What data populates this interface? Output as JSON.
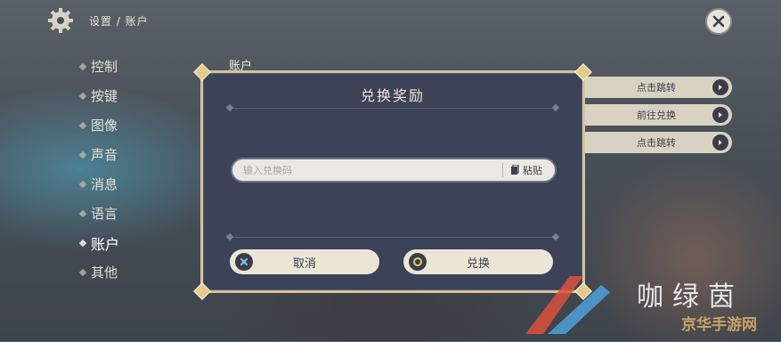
{
  "topbar": {
    "breadcrumb": "设置 / 账户"
  },
  "sidebar": {
    "items": [
      {
        "label": "控制"
      },
      {
        "label": "按键"
      },
      {
        "label": "图像"
      },
      {
        "label": "声音"
      },
      {
        "label": "消息"
      },
      {
        "label": "语言"
      },
      {
        "label": "账户",
        "active": true
      },
      {
        "label": "其他"
      }
    ]
  },
  "main": {
    "section_title": "账户",
    "buttons": [
      {
        "label": "点击跳转"
      },
      {
        "label": "前往兑换"
      },
      {
        "label": "点击跳转"
      }
    ]
  },
  "dialog": {
    "title": "兑换奖励",
    "input_placeholder": "输入兑换码",
    "input_value": "",
    "paste_label": "粘贴",
    "cancel_label": "取消",
    "confirm_label": "兑换"
  },
  "watermark": {
    "big": "咖绿茵",
    "small": "京华手游网"
  },
  "colors": {
    "dialog_bg": "#3c4257",
    "dialog_border": "#d4c29a",
    "button_bg": "#ece5d6",
    "text_dark": "#3b3e4a"
  }
}
